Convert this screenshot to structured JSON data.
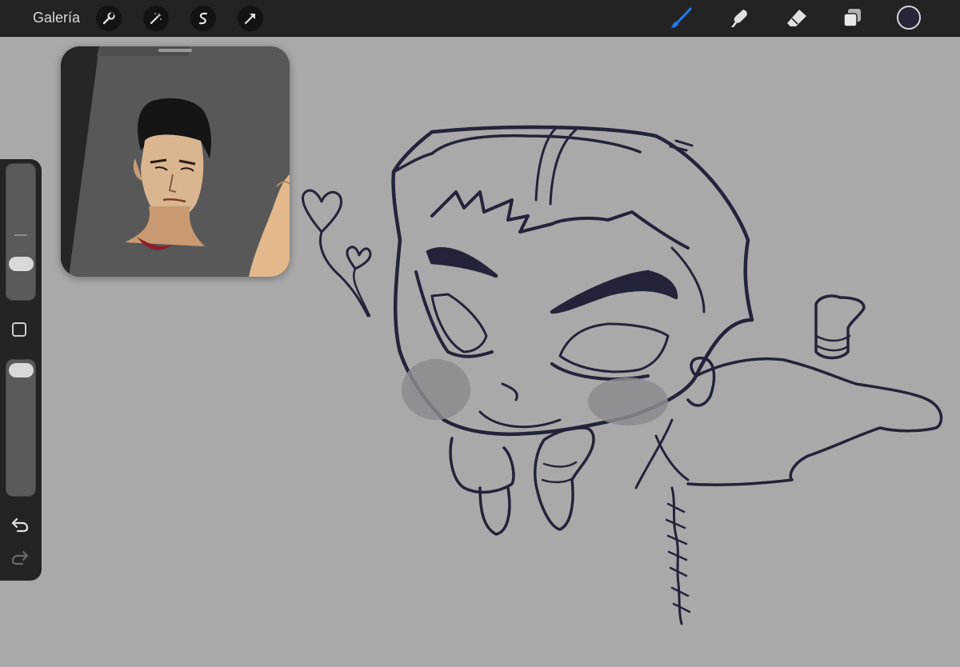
{
  "topbar": {
    "gallery_label": "Galería",
    "left_tools": [
      {
        "icon": "wrench-icon"
      },
      {
        "icon": "magic-wand-icon"
      },
      {
        "icon": "selection-s-icon"
      },
      {
        "icon": "transform-arrow-icon"
      }
    ],
    "right_tools": [
      {
        "icon": "brush-icon",
        "active": true
      },
      {
        "icon": "smudge-icon"
      },
      {
        "icon": "eraser-icon"
      },
      {
        "icon": "layers-icon"
      }
    ],
    "current_color": "#262638",
    "accent_color": "#1e7cf2"
  },
  "sidebar": {
    "brush_size_level": 0.28,
    "opacity_level": 0.05,
    "modifier_icon": "square-modify-icon",
    "undo_icon": "undo-icon",
    "redo_icon": "redo-icon"
  },
  "reference_window": {
    "icon": "reference-portrait-image"
  }
}
